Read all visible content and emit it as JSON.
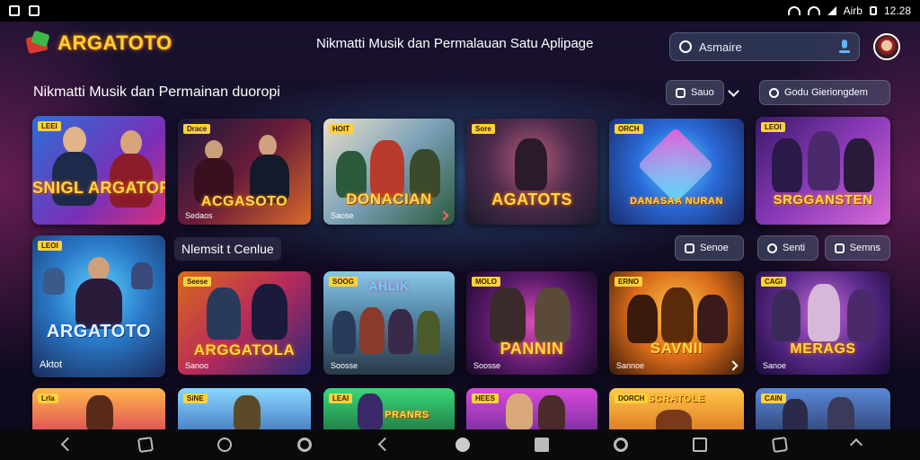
{
  "app": {
    "logo_text": "ARGATOTO",
    "header_title": "Nikmatti Musik dan Permalauan Satu Aplipage",
    "search_placeholder": "Asmaire",
    "accent": "#ffcf33"
  },
  "section1": {
    "title": "Nikmatti Musik dan Permainan duoropi",
    "chip_left": "Sauo",
    "chip_right": "Godu Gieriongdem"
  },
  "section2": {
    "title": "Nlemsit t Cenlue",
    "chip_a": "Senoe",
    "chip_b": "Senti",
    "chip_c": "Semns"
  },
  "row1": [
    {
      "title": "SNIGL ARGATORO",
      "sub": "",
      "badge": "LEEI"
    },
    {
      "title": "ACGASOTO",
      "sub": "Sedaos",
      "badge": "Drace"
    },
    {
      "title": "DONACIAN",
      "sub": "Saose",
      "badge": "HOIT"
    },
    {
      "title": "AGATOTS",
      "sub": "",
      "badge": "Sore"
    },
    {
      "title": "DANASAA NURAN",
      "sub": "",
      "badge": "ORCH"
    },
    {
      "title": "SRGGANSTEN",
      "sub": "",
      "badge": "LEOI"
    }
  ],
  "featured": {
    "title": "ARGATOTO",
    "sub": "Aktot",
    "badge": "LEOI"
  },
  "row2": [
    {
      "title": "ARGGATOLA",
      "sub": "Sanoo",
      "badge": "Seese"
    },
    {
      "title": "AHLIK",
      "sub": "Soosse",
      "badge": "SOOG"
    },
    {
      "title": "PANNIN",
      "sub": "Soosse",
      "badge": "MOLO"
    },
    {
      "title": "SAVNII",
      "sub": "Sannoe",
      "badge": "ERNO"
    },
    {
      "title": "MERAGS",
      "sub": "Sanoe",
      "badge": "CAGI"
    }
  ],
  "row3": [
    {
      "title": "",
      "badge": "Lrla"
    },
    {
      "title": "",
      "badge": "SiNE"
    },
    {
      "title": "PRANRS",
      "badge": "LEAI"
    },
    {
      "title": "",
      "badge": "HEES"
    },
    {
      "title": "SCRATOLE",
      "badge": "DORCH"
    },
    {
      "title": "",
      "badge": "CAIN"
    }
  ],
  "status": {
    "time": "12.28",
    "carrier": "Airb"
  }
}
